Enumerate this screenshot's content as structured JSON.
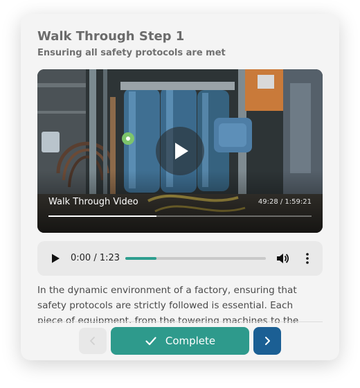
{
  "step": {
    "title": "Walk Through Step 1",
    "subtitle": "Ensuring all safety protocols are met"
  },
  "video": {
    "label": "Walk Through Video",
    "time": "49:28 / 1:59:21",
    "progress_fraction": 0.41,
    "play_icon": "play-icon"
  },
  "audio": {
    "time": "0:00 / 1:23",
    "progress_fraction": 0.22,
    "play_icon": "play-icon",
    "volume_icon": "volume-icon",
    "menu_icon": "more-vertical-icon"
  },
  "body": {
    "text": "In the dynamic environment of a factory, ensuring that safety protocols are strictly followed is essential. Each piece of equipment, from the towering machines to the"
  },
  "footer": {
    "complete_label": "Complete",
    "prev_icon": "chevron-left-icon",
    "next_icon": "chevron-right-icon"
  },
  "colors": {
    "accent": "#2e9a8c",
    "next_button": "#1b5f94"
  }
}
